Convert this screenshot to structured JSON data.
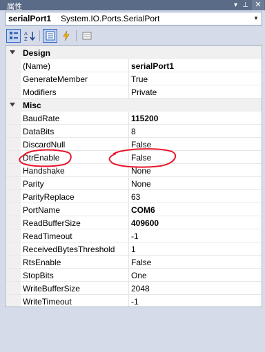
{
  "window": {
    "title": "属性",
    "icons": [
      "dropdown-icon",
      "pin-icon",
      "close-icon"
    ]
  },
  "object_selector": {
    "name": "serialPort1",
    "type": "System.IO.Ports.SerialPort"
  },
  "toolbar": {
    "buttons": [
      "categorized-icon",
      "alphabetical-icon",
      "properties-icon",
      "events-icon",
      "property-pages-icon"
    ]
  },
  "categories": [
    {
      "name": "Design",
      "rows": [
        {
          "name": "(Name)",
          "value": "serialPort1",
          "bold": true
        },
        {
          "name": "GenerateMember",
          "value": "True",
          "bold": false
        },
        {
          "name": "Modifiers",
          "value": "Private",
          "bold": false
        }
      ]
    },
    {
      "name": "Misc",
      "rows": [
        {
          "name": "BaudRate",
          "value": "115200",
          "bold": true
        },
        {
          "name": "DataBits",
          "value": "8",
          "bold": false
        },
        {
          "name": "DiscardNull",
          "value": "False",
          "bold": false
        },
        {
          "name": "DtrEnable",
          "value": "False",
          "bold": false
        },
        {
          "name": "Handshake",
          "value": "None",
          "bold": false
        },
        {
          "name": "Parity",
          "value": "None",
          "bold": false
        },
        {
          "name": "ParityReplace",
          "value": "63",
          "bold": false
        },
        {
          "name": "PortName",
          "value": "COM6",
          "bold": true
        },
        {
          "name": "ReadBufferSize",
          "value": "409600",
          "bold": true
        },
        {
          "name": "ReadTimeout",
          "value": "-1",
          "bold": false
        },
        {
          "name": "ReceivedBytesThreshold",
          "value": "1",
          "bold": false
        },
        {
          "name": "RtsEnable",
          "value": "False",
          "bold": false
        },
        {
          "name": "StopBits",
          "value": "One",
          "bold": false
        },
        {
          "name": "WriteBufferSize",
          "value": "2048",
          "bold": false
        },
        {
          "name": "WriteTimeout",
          "value": "-1",
          "bold": false
        }
      ]
    }
  ],
  "annotation_color": "#e8142a",
  "colors": {
    "titlebar": "#5a6b88",
    "chrome": "#d6dbe9",
    "gutter": "#f0f0f0"
  }
}
